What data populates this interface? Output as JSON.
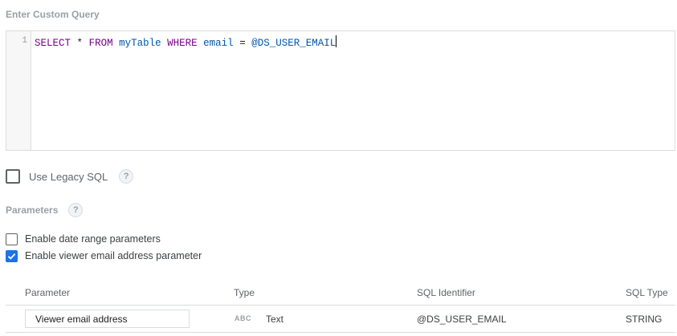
{
  "query_section": {
    "title": "Enter Custom Query"
  },
  "editor": {
    "line_number": "1",
    "tokens": {
      "select": "SELECT",
      "star": "*",
      "from": "FROM",
      "table": "myTable",
      "where": "WHERE",
      "column": "email",
      "equals": "=",
      "param": "@DS_USER_EMAIL"
    }
  },
  "legacy_sql": {
    "label": "Use Legacy SQL",
    "checked": false,
    "help": "?"
  },
  "parameters": {
    "title": "Parameters",
    "help": "?",
    "options": [
      {
        "label": "Enable date range parameters",
        "checked": false
      },
      {
        "label": "Enable viewer email address parameter",
        "checked": true
      }
    ]
  },
  "table": {
    "headers": {
      "parameter": "Parameter",
      "type": "Type",
      "sql_identifier": "SQL Identifier",
      "sql_type": "SQL Type"
    },
    "rows": [
      {
        "name": "Viewer email address",
        "type_icon": "ABC",
        "type": "Text",
        "sql_identifier": "@DS_USER_EMAIL",
        "sql_type": "STRING"
      }
    ]
  },
  "colors": {
    "accent": "#1a73e8",
    "keyword": "#770088",
    "variable": "#0055aa"
  }
}
